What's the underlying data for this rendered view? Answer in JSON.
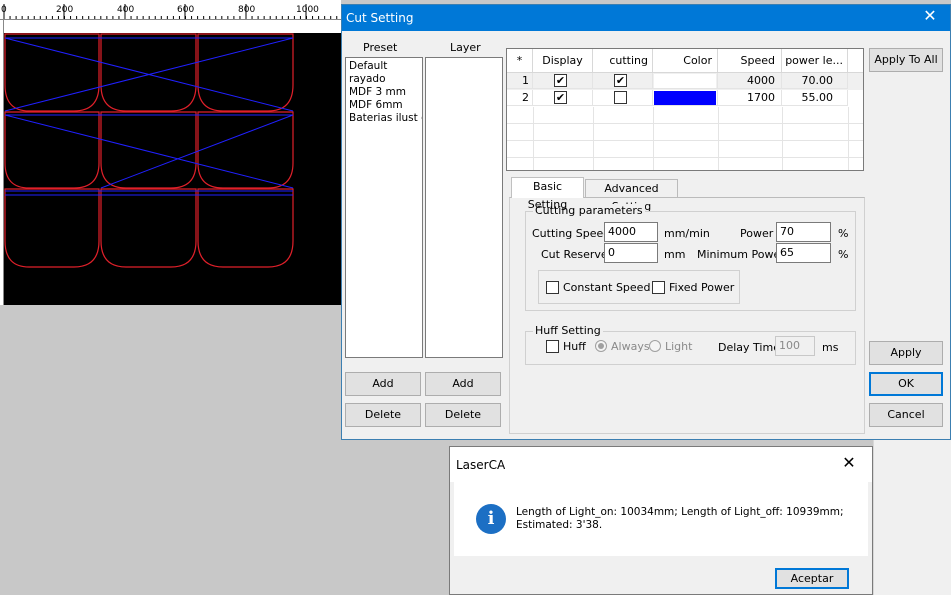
{
  "ruler": {
    "labels": [
      "0",
      "200",
      "400",
      "600",
      "800",
      "1000"
    ]
  },
  "cut_setting": {
    "title": "Cut Setting",
    "close_glyph": "✕",
    "preset_header": "Preset",
    "layer_header": "Layer",
    "presets": [
      "Default",
      "rayado",
      "MDF 3 mm",
      "MDF 6mm",
      "Baterias ilust co"
    ],
    "buttons": {
      "add_preset": "Add",
      "add_layer": "Add",
      "delete_preset": "Delete",
      "delete_layer": "Delete",
      "apply_to_all": "Apply To All",
      "apply": "Apply",
      "ok": "OK",
      "cancel": "Cancel"
    },
    "table": {
      "headers": [
        "*",
        "Display",
        "cutting",
        "Color",
        "Speed",
        "power le..."
      ],
      "rows": [
        {
          "num": "1",
          "display": "✔",
          "cutting": "✔",
          "color": "#ffffff",
          "speed": "4000",
          "power": "70.00"
        },
        {
          "num": "2",
          "display": "✔",
          "cutting": "",
          "color": "#0000ff",
          "speed": "1700",
          "power": "55.00"
        }
      ]
    },
    "tabs": {
      "basic": "Basic Setting",
      "advanced": "Advanced Setting"
    },
    "cutting_params": {
      "title": "Cutting parameters",
      "cutting_speed_label": "Cutting Speed",
      "cutting_speed_value": "4000",
      "speed_unit": "mm/min",
      "cut_reserve_label": "Cut Reserve",
      "cut_reserve_value": "0",
      "reserve_unit": "mm",
      "power_label": "Power",
      "power_value": "70",
      "power_unit": "%",
      "min_power_label": "Minimum Power",
      "min_power_value": "65",
      "min_power_unit": "%",
      "constant_speed_label": "Constant Speed",
      "fixed_power_label": "Fixed Power"
    },
    "huff": {
      "title": "Huff Setting",
      "huff_label": "Huff",
      "always_label": "Always",
      "light_label": "Light",
      "delay_label": "Delay Time",
      "delay_value": "100",
      "delay_unit": "ms"
    }
  },
  "laser_dialog": {
    "title": "LaserCA",
    "close_glyph": "✕",
    "icon_glyph": "i",
    "message_line1": "Length of Light_on: 10034mm; Length of Light_off: 10939mm;",
    "message_line2": "Estimated: 3'38.",
    "accept_button": "Aceptar"
  }
}
